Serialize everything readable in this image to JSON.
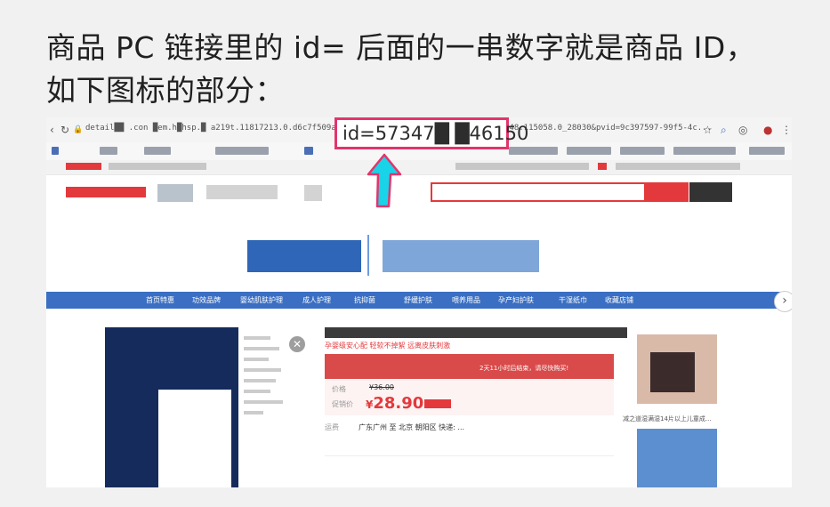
{
  "caption": {
    "line1": "商品 PC 链接里的 id= 后面的一串数字就是商品 ID，",
    "line2": "如下图标的部分："
  },
  "browser": {
    "url_left": "detail██ .con  █em.h█hsp.█ a219t.11817213.0.d6c7f509a.42b",
    "url_right": "348.115058.0_28030&pvid=9c397597-99f5-4c...",
    "highlight_text": "id=57347█ █46150"
  },
  "store_nav": {
    "items": [
      "首页特惠",
      "功效品牌",
      "婴幼肌肤护理",
      "成人护理",
      "抗抑菌",
      "舒缓护肤",
      "喂养用品",
      "孕产妇护肤",
      "干湿纸巾",
      "收藏店铺"
    ]
  },
  "product": {
    "subtitle": "孕婴级安心配 轻软不掉絮 远离皮肤刺激",
    "promo_tag": "2天11小时后结束，请尽快购买!",
    "price_label": "价格",
    "promo_label": "促销价",
    "old_price": "¥36.00",
    "new_price_symbol": "¥",
    "new_price": "28.90",
    "ship_label": "运费",
    "ship_text": "广东广州 至 北京 朝阳区 快递: ..."
  },
  "reco": {
    "caption": "减之道湿满湿14片以上儿童成..."
  },
  "colors": {
    "accent_red": "#e4393c",
    "highlight_pink": "#e3346c",
    "arrow_cyan": "#19d3e8",
    "nav_blue": "#3a6fc3"
  }
}
